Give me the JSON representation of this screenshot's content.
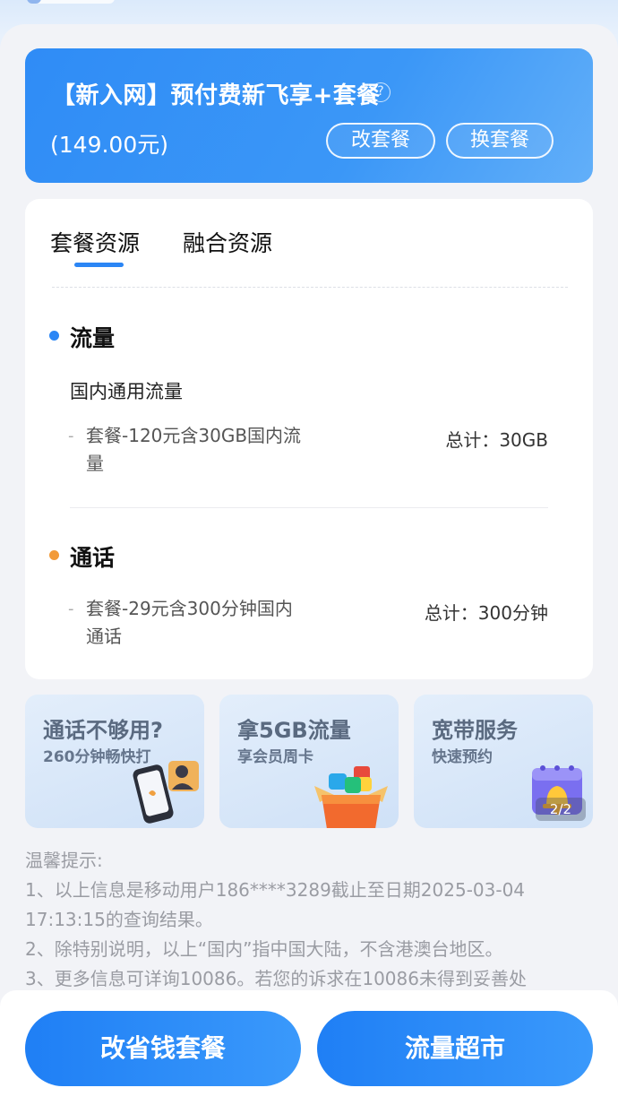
{
  "plan": {
    "title": "【新入网】预付费新飞享+套餐",
    "price": "(149.00元)",
    "change_label": "改套餐",
    "swap_label": "换套餐",
    "help_icon": "question-circle-icon"
  },
  "resources": {
    "tabs": [
      "套餐资源",
      "融合资源"
    ],
    "active_tab": "套餐资源",
    "sections": [
      {
        "title": "流量",
        "dot_color": "#2b86f5",
        "subtitle": "国内通用流量",
        "item_line1": "套餐-120元含30GB国内流",
        "item_line2": "量",
        "total": "总计：30GB"
      },
      {
        "title": "通话",
        "dot_color": "#f29a38",
        "item_line1": "套餐-29元含300分钟国内",
        "item_line2": "通话",
        "total": "总计：300分钟"
      }
    ]
  },
  "promos": [
    {
      "title": "通话不够用?",
      "subtitle": "260分钟畅快打",
      "icon": "phone-call-icon"
    },
    {
      "title": "拿5GB流量",
      "subtitle": "享会员周卡",
      "icon": "gift-box-icon"
    },
    {
      "title": "宽带服务",
      "subtitle": "快速预约",
      "icon": "calendar-bell-icon",
      "pager": "2/2"
    }
  ],
  "tips": {
    "heading": "温馨提示:",
    "lines": [
      "1、以上信息是移动用户186****3289截止至日期2025-03-04",
      "17:13:15的查询结果。",
      "2、除特别说明，以上“国内”指中国大陆，不含港澳台地区。",
      "3、更多信息可详询10086。若您的诉求在10086未得到妥善处"
    ]
  },
  "actions": {
    "save_label": "改省钱套餐",
    "market_label": "流量超市"
  },
  "colors": {
    "accent": "#2b86f5",
    "call_dot": "#f29a38"
  }
}
